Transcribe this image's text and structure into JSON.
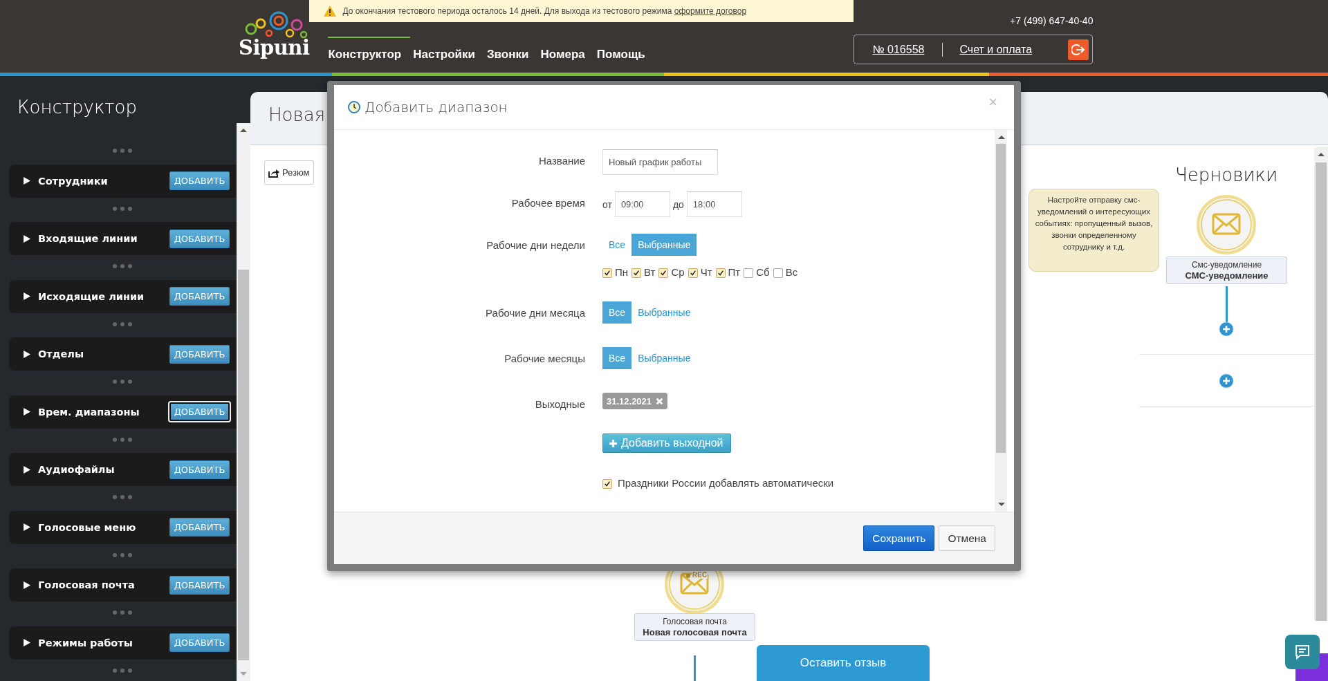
{
  "header": {
    "logo": "Sipuni",
    "notice": {
      "text": "До окончания тестового периода осталось 14 дней. Для выхода из тестового режима ",
      "link": "оформите договор"
    },
    "nav": [
      {
        "label": "Конструктор",
        "selected": true
      },
      {
        "label": "Настройки",
        "selected": false
      },
      {
        "label": "Звонки",
        "selected": false
      },
      {
        "label": "Номера",
        "selected": false
      },
      {
        "label": "Помощь",
        "selected": false
      }
    ],
    "phone": "+7 (499) 647-40-40",
    "account": {
      "number": "№ 016558",
      "billing": "Счет и оплата"
    }
  },
  "sidebar": {
    "title": "Конструктор",
    "items": [
      {
        "label": "Сотрудники",
        "action": "ДОБАВИТЬ",
        "focused": false
      },
      {
        "label": "Входящие линии",
        "action": "ДОБАВИТЬ",
        "focused": false
      },
      {
        "label": "Исходящие линии",
        "action": "ДОБАВИТЬ",
        "focused": false
      },
      {
        "label": "Отделы",
        "action": "ДОБАВИТЬ",
        "focused": false
      },
      {
        "label": "Врем. диапазоны",
        "action": "ДОБАВИТЬ",
        "focused": true
      },
      {
        "label": "Аудиофайлы",
        "action": "ДОБАВИТЬ",
        "focused": false
      },
      {
        "label": "Голосовые меню",
        "action": "ДОБАВИТЬ",
        "focused": false
      },
      {
        "label": "Голосовая почта",
        "action": "ДОБАВИТЬ",
        "focused": false
      },
      {
        "label": "Режимы работы",
        "action": "ДОБАВИТЬ",
        "focused": false
      }
    ]
  },
  "main": {
    "title": "Новая",
    "toolbar_button": "Резюм",
    "drafts": {
      "title": "Черновики",
      "hint": "Настройте отправку смс-уведомлений о интересующих событиях: пропущенный вызов, звонки определенному сотруднику и т.д.",
      "node": {
        "type": "Смс-уведомление",
        "name": "СМС-уведомление"
      }
    },
    "voicemail_node": {
      "rec_label": "REC",
      "type": "Голосовая почта",
      "name": "Новая голосовая почта"
    },
    "feedback_button": "Оставить отзыв"
  },
  "dialog": {
    "title": "Добавить диапазон",
    "close": "×",
    "fields": [
      {
        "kind": "text",
        "label": "Название",
        "value": "Новый график работы"
      },
      {
        "kind": "range",
        "label": "Рабочее время",
        "from_label": "от",
        "from": "09:00",
        "to_label": "до",
        "to": "18:00"
      },
      {
        "kind": "choice",
        "label": "Рабочие дни недели",
        "options": [
          {
            "label": "Все",
            "selected": false
          },
          {
            "label": "Выбранные",
            "selected": true
          }
        ],
        "days": [
          {
            "label": "Пн",
            "checked": true
          },
          {
            "label": "Вт",
            "checked": true
          },
          {
            "label": "Ср",
            "checked": true
          },
          {
            "label": "Чт",
            "checked": true
          },
          {
            "label": "Пт",
            "checked": true
          },
          {
            "label": "Сб",
            "checked": false
          },
          {
            "label": "Вс",
            "checked": false
          }
        ]
      },
      {
        "kind": "choice",
        "label": "Рабочие дни месяца",
        "options": [
          {
            "label": "Все",
            "selected": true
          },
          {
            "label": "Выбранные",
            "selected": false
          }
        ]
      },
      {
        "kind": "choice",
        "label": "Рабочие месяцы",
        "options": [
          {
            "label": "Все",
            "selected": true
          },
          {
            "label": "Выбранные",
            "selected": false
          }
        ]
      },
      {
        "kind": "tags",
        "label": "Выходные",
        "tags": [
          "31.12.2021"
        ]
      },
      {
        "kind": "button",
        "label": "Добавить выходной"
      },
      {
        "kind": "checkbox",
        "label": "Праздники России добавлять автоматически",
        "checked": true
      }
    ],
    "buttons": [
      {
        "label": "Сохранить",
        "kind": "primary"
      },
      {
        "label": "Отмена",
        "kind": "default"
      }
    ]
  }
}
